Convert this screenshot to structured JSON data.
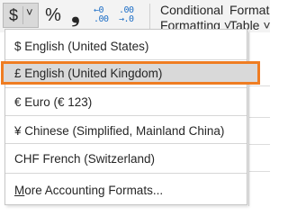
{
  "ribbon": {
    "currency_symbol": "$",
    "caret": "˅",
    "percent": "%",
    "comma": "❟",
    "increase_decimal": {
      "line1": "←0",
      "line2": ".00"
    },
    "decrease_decimal": {
      "line1": ".00",
      "line2": "→.0"
    },
    "conditional_formatting": {
      "line1": "Conditional",
      "line2": "Formatting ˅"
    },
    "format_table": {
      "line1": "Format",
      "line2": "Table ˅"
    }
  },
  "menu": {
    "items": [
      {
        "label": "$ English (United States)",
        "selected": false
      },
      {
        "label": "£ English (United Kingdom)",
        "selected": true
      },
      {
        "label": "€ Euro (€ 123)",
        "selected": false
      },
      {
        "label": "¥ Chinese (Simplified, Mainland China)",
        "selected": false
      },
      {
        "label": "CHF French (Switzerland)",
        "selected": false
      }
    ],
    "more": {
      "underlined": "M",
      "rest": "ore Accounting Formats..."
    }
  },
  "colors": {
    "highlight_border": "#ef7d22",
    "selected_bg": "#d9d9d9",
    "ribbon_bg": "#f3f3f3",
    "decimal_icon": "#1e6fc7"
  }
}
